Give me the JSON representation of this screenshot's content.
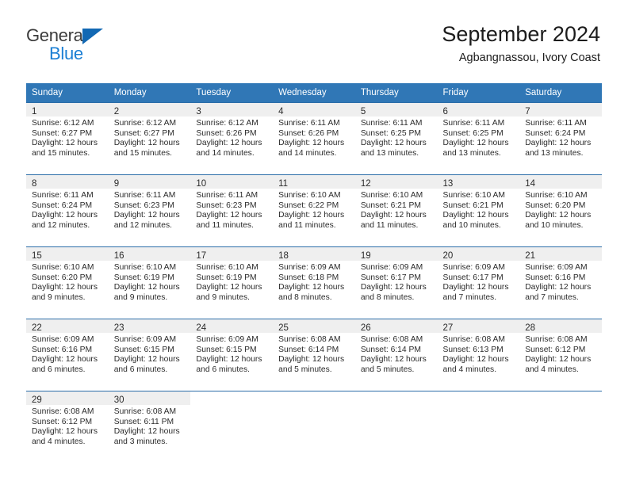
{
  "brand": {
    "name_top": "General",
    "name_bottom": "Blue",
    "triangle_color": "#1268b3",
    "text_color": "#3b3b3b",
    "blue_text_color": "#1b7fd4"
  },
  "header": {
    "title": "September 2024",
    "subtitle": "Agbangnassou, Ivory Coast"
  },
  "theme": {
    "header_row_bg": "#3077b6",
    "row_rule": "#2b6da8",
    "daynum_band_bg": "#efefef",
    "text": "#2b2b2b"
  },
  "weekday_headers": [
    "Sunday",
    "Monday",
    "Tuesday",
    "Wednesday",
    "Thursday",
    "Friday",
    "Saturday"
  ],
  "weeks": [
    [
      {
        "day": "1",
        "sunrise": "Sunrise: 6:12 AM",
        "sunset": "Sunset: 6:27 PM",
        "daylight_1": "Daylight: 12 hours",
        "daylight_2": "and 15 minutes."
      },
      {
        "day": "2",
        "sunrise": "Sunrise: 6:12 AM",
        "sunset": "Sunset: 6:27 PM",
        "daylight_1": "Daylight: 12 hours",
        "daylight_2": "and 15 minutes."
      },
      {
        "day": "3",
        "sunrise": "Sunrise: 6:12 AM",
        "sunset": "Sunset: 6:26 PM",
        "daylight_1": "Daylight: 12 hours",
        "daylight_2": "and 14 minutes."
      },
      {
        "day": "4",
        "sunrise": "Sunrise: 6:11 AM",
        "sunset": "Sunset: 6:26 PM",
        "daylight_1": "Daylight: 12 hours",
        "daylight_2": "and 14 minutes."
      },
      {
        "day": "5",
        "sunrise": "Sunrise: 6:11 AM",
        "sunset": "Sunset: 6:25 PM",
        "daylight_1": "Daylight: 12 hours",
        "daylight_2": "and 13 minutes."
      },
      {
        "day": "6",
        "sunrise": "Sunrise: 6:11 AM",
        "sunset": "Sunset: 6:25 PM",
        "daylight_1": "Daylight: 12 hours",
        "daylight_2": "and 13 minutes."
      },
      {
        "day": "7",
        "sunrise": "Sunrise: 6:11 AM",
        "sunset": "Sunset: 6:24 PM",
        "daylight_1": "Daylight: 12 hours",
        "daylight_2": "and 13 minutes."
      }
    ],
    [
      {
        "day": "8",
        "sunrise": "Sunrise: 6:11 AM",
        "sunset": "Sunset: 6:24 PM",
        "daylight_1": "Daylight: 12 hours",
        "daylight_2": "and 12 minutes."
      },
      {
        "day": "9",
        "sunrise": "Sunrise: 6:11 AM",
        "sunset": "Sunset: 6:23 PM",
        "daylight_1": "Daylight: 12 hours",
        "daylight_2": "and 12 minutes."
      },
      {
        "day": "10",
        "sunrise": "Sunrise: 6:11 AM",
        "sunset": "Sunset: 6:23 PM",
        "daylight_1": "Daylight: 12 hours",
        "daylight_2": "and 11 minutes."
      },
      {
        "day": "11",
        "sunrise": "Sunrise: 6:10 AM",
        "sunset": "Sunset: 6:22 PM",
        "daylight_1": "Daylight: 12 hours",
        "daylight_2": "and 11 minutes."
      },
      {
        "day": "12",
        "sunrise": "Sunrise: 6:10 AM",
        "sunset": "Sunset: 6:21 PM",
        "daylight_1": "Daylight: 12 hours",
        "daylight_2": "and 11 minutes."
      },
      {
        "day": "13",
        "sunrise": "Sunrise: 6:10 AM",
        "sunset": "Sunset: 6:21 PM",
        "daylight_1": "Daylight: 12 hours",
        "daylight_2": "and 10 minutes."
      },
      {
        "day": "14",
        "sunrise": "Sunrise: 6:10 AM",
        "sunset": "Sunset: 6:20 PM",
        "daylight_1": "Daylight: 12 hours",
        "daylight_2": "and 10 minutes."
      }
    ],
    [
      {
        "day": "15",
        "sunrise": "Sunrise: 6:10 AM",
        "sunset": "Sunset: 6:20 PM",
        "daylight_1": "Daylight: 12 hours",
        "daylight_2": "and 9 minutes."
      },
      {
        "day": "16",
        "sunrise": "Sunrise: 6:10 AM",
        "sunset": "Sunset: 6:19 PM",
        "daylight_1": "Daylight: 12 hours",
        "daylight_2": "and 9 minutes."
      },
      {
        "day": "17",
        "sunrise": "Sunrise: 6:10 AM",
        "sunset": "Sunset: 6:19 PM",
        "daylight_1": "Daylight: 12 hours",
        "daylight_2": "and 9 minutes."
      },
      {
        "day": "18",
        "sunrise": "Sunrise: 6:09 AM",
        "sunset": "Sunset: 6:18 PM",
        "daylight_1": "Daylight: 12 hours",
        "daylight_2": "and 8 minutes."
      },
      {
        "day": "19",
        "sunrise": "Sunrise: 6:09 AM",
        "sunset": "Sunset: 6:17 PM",
        "daylight_1": "Daylight: 12 hours",
        "daylight_2": "and 8 minutes."
      },
      {
        "day": "20",
        "sunrise": "Sunrise: 6:09 AM",
        "sunset": "Sunset: 6:17 PM",
        "daylight_1": "Daylight: 12 hours",
        "daylight_2": "and 7 minutes."
      },
      {
        "day": "21",
        "sunrise": "Sunrise: 6:09 AM",
        "sunset": "Sunset: 6:16 PM",
        "daylight_1": "Daylight: 12 hours",
        "daylight_2": "and 7 minutes."
      }
    ],
    [
      {
        "day": "22",
        "sunrise": "Sunrise: 6:09 AM",
        "sunset": "Sunset: 6:16 PM",
        "daylight_1": "Daylight: 12 hours",
        "daylight_2": "and 6 minutes."
      },
      {
        "day": "23",
        "sunrise": "Sunrise: 6:09 AM",
        "sunset": "Sunset: 6:15 PM",
        "daylight_1": "Daylight: 12 hours",
        "daylight_2": "and 6 minutes."
      },
      {
        "day": "24",
        "sunrise": "Sunrise: 6:09 AM",
        "sunset": "Sunset: 6:15 PM",
        "daylight_1": "Daylight: 12 hours",
        "daylight_2": "and 6 minutes."
      },
      {
        "day": "25",
        "sunrise": "Sunrise: 6:08 AM",
        "sunset": "Sunset: 6:14 PM",
        "daylight_1": "Daylight: 12 hours",
        "daylight_2": "and 5 minutes."
      },
      {
        "day": "26",
        "sunrise": "Sunrise: 6:08 AM",
        "sunset": "Sunset: 6:14 PM",
        "daylight_1": "Daylight: 12 hours",
        "daylight_2": "and 5 minutes."
      },
      {
        "day": "27",
        "sunrise": "Sunrise: 6:08 AM",
        "sunset": "Sunset: 6:13 PM",
        "daylight_1": "Daylight: 12 hours",
        "daylight_2": "and 4 minutes."
      },
      {
        "day": "28",
        "sunrise": "Sunrise: 6:08 AM",
        "sunset": "Sunset: 6:12 PM",
        "daylight_1": "Daylight: 12 hours",
        "daylight_2": "and 4 minutes."
      }
    ],
    [
      {
        "day": "29",
        "sunrise": "Sunrise: 6:08 AM",
        "sunset": "Sunset: 6:12 PM",
        "daylight_1": "Daylight: 12 hours",
        "daylight_2": "and 4 minutes."
      },
      {
        "day": "30",
        "sunrise": "Sunrise: 6:08 AM",
        "sunset": "Sunset: 6:11 PM",
        "daylight_1": "Daylight: 12 hours",
        "daylight_2": "and 3 minutes."
      },
      {
        "day": "",
        "sunrise": "",
        "sunset": "",
        "daylight_1": "",
        "daylight_2": ""
      },
      {
        "day": "",
        "sunrise": "",
        "sunset": "",
        "daylight_1": "",
        "daylight_2": ""
      },
      {
        "day": "",
        "sunrise": "",
        "sunset": "",
        "daylight_1": "",
        "daylight_2": ""
      },
      {
        "day": "",
        "sunrise": "",
        "sunset": "",
        "daylight_1": "",
        "daylight_2": ""
      },
      {
        "day": "",
        "sunrise": "",
        "sunset": "",
        "daylight_1": "",
        "daylight_2": ""
      }
    ]
  ]
}
